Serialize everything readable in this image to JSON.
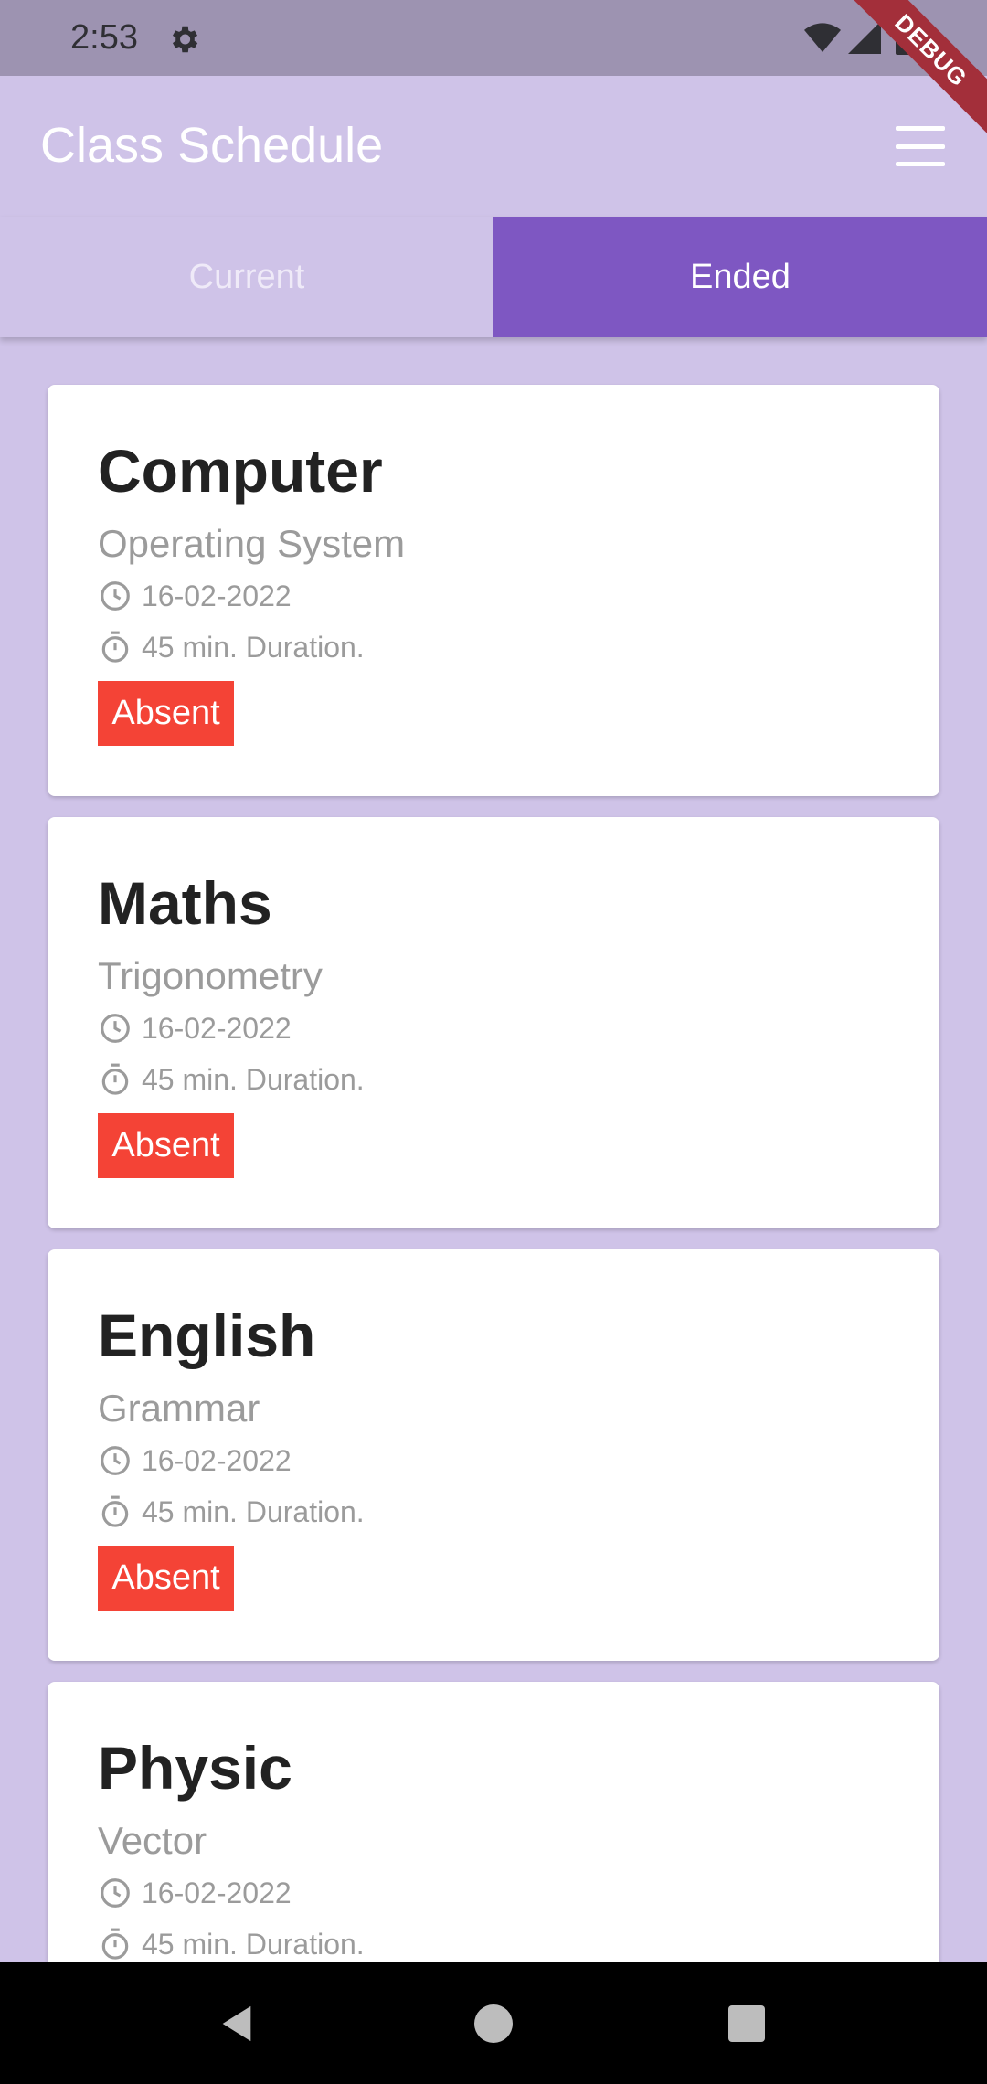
{
  "status_bar": {
    "time": "2:53",
    "icons": [
      "gear-icon",
      "wifi-icon",
      "signal-icon",
      "battery-icon"
    ]
  },
  "debug_banner": "DEBUG",
  "app_bar": {
    "title": "Class Schedule",
    "menu_icon": "hamburger-menu-icon"
  },
  "tabs": [
    {
      "label": "Current",
      "selected": false
    },
    {
      "label": "Ended",
      "selected": true
    }
  ],
  "classes": [
    {
      "subject": "Computer",
      "topic": "Operating System",
      "date": "16-02-2022",
      "duration": "45 min. Duration.",
      "status": "Absent"
    },
    {
      "subject": "Maths",
      "topic": "Trigonometry",
      "date": "16-02-2022",
      "duration": "45 min. Duration.",
      "status": "Absent"
    },
    {
      "subject": "English",
      "topic": "Grammar",
      "date": "16-02-2022",
      "duration": "45 min. Duration.",
      "status": "Absent"
    },
    {
      "subject": "Physic",
      "topic": "Vector",
      "date": "16-02-2022",
      "duration": "45 min. Duration."
    }
  ],
  "colors": {
    "primary": "#7e57c2",
    "primary_light": "#cfc3e8",
    "absent": "#f44336",
    "status_bar": "#9d93b1"
  },
  "nav_bar": {
    "icons": [
      "back-icon",
      "home-icon",
      "recents-icon"
    ]
  }
}
